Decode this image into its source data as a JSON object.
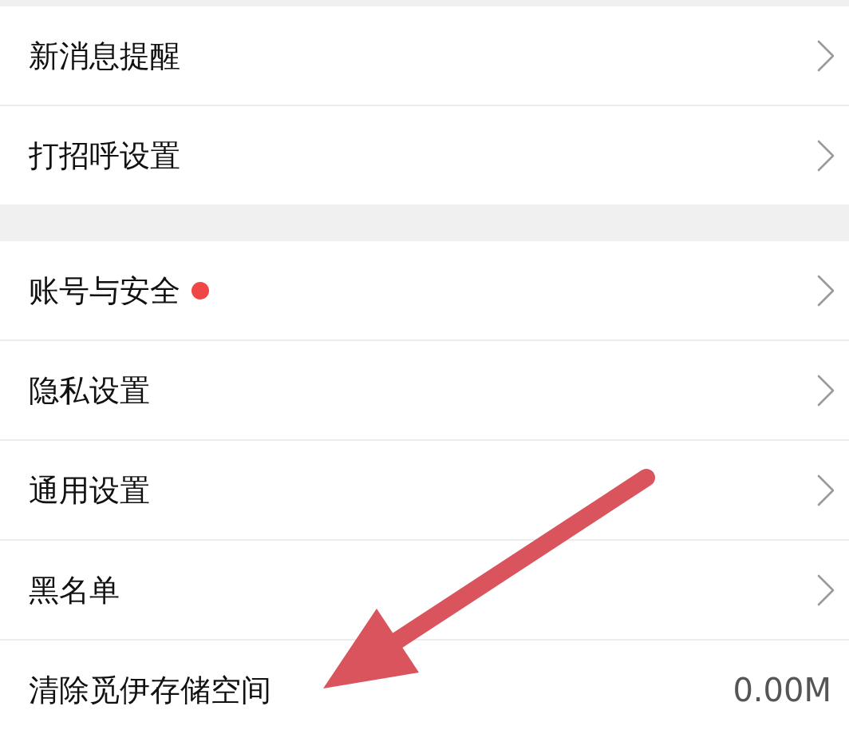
{
  "sections": [
    {
      "items": [
        {
          "label": "新消息提醒",
          "kind": "link",
          "badge": false
        },
        {
          "label": "打招呼设置",
          "kind": "link",
          "badge": false
        }
      ]
    },
    {
      "items": [
        {
          "label": "账号与安全",
          "kind": "link",
          "badge": true
        },
        {
          "label": "隐私设置",
          "kind": "link",
          "badge": false
        },
        {
          "label": "通用设置",
          "kind": "link",
          "badge": false
        },
        {
          "label": "黑名单",
          "kind": "link",
          "badge": false
        },
        {
          "label": "清除觅伊存储空间",
          "kind": "value",
          "badge": false,
          "value": "0.00M"
        }
      ]
    }
  ]
}
